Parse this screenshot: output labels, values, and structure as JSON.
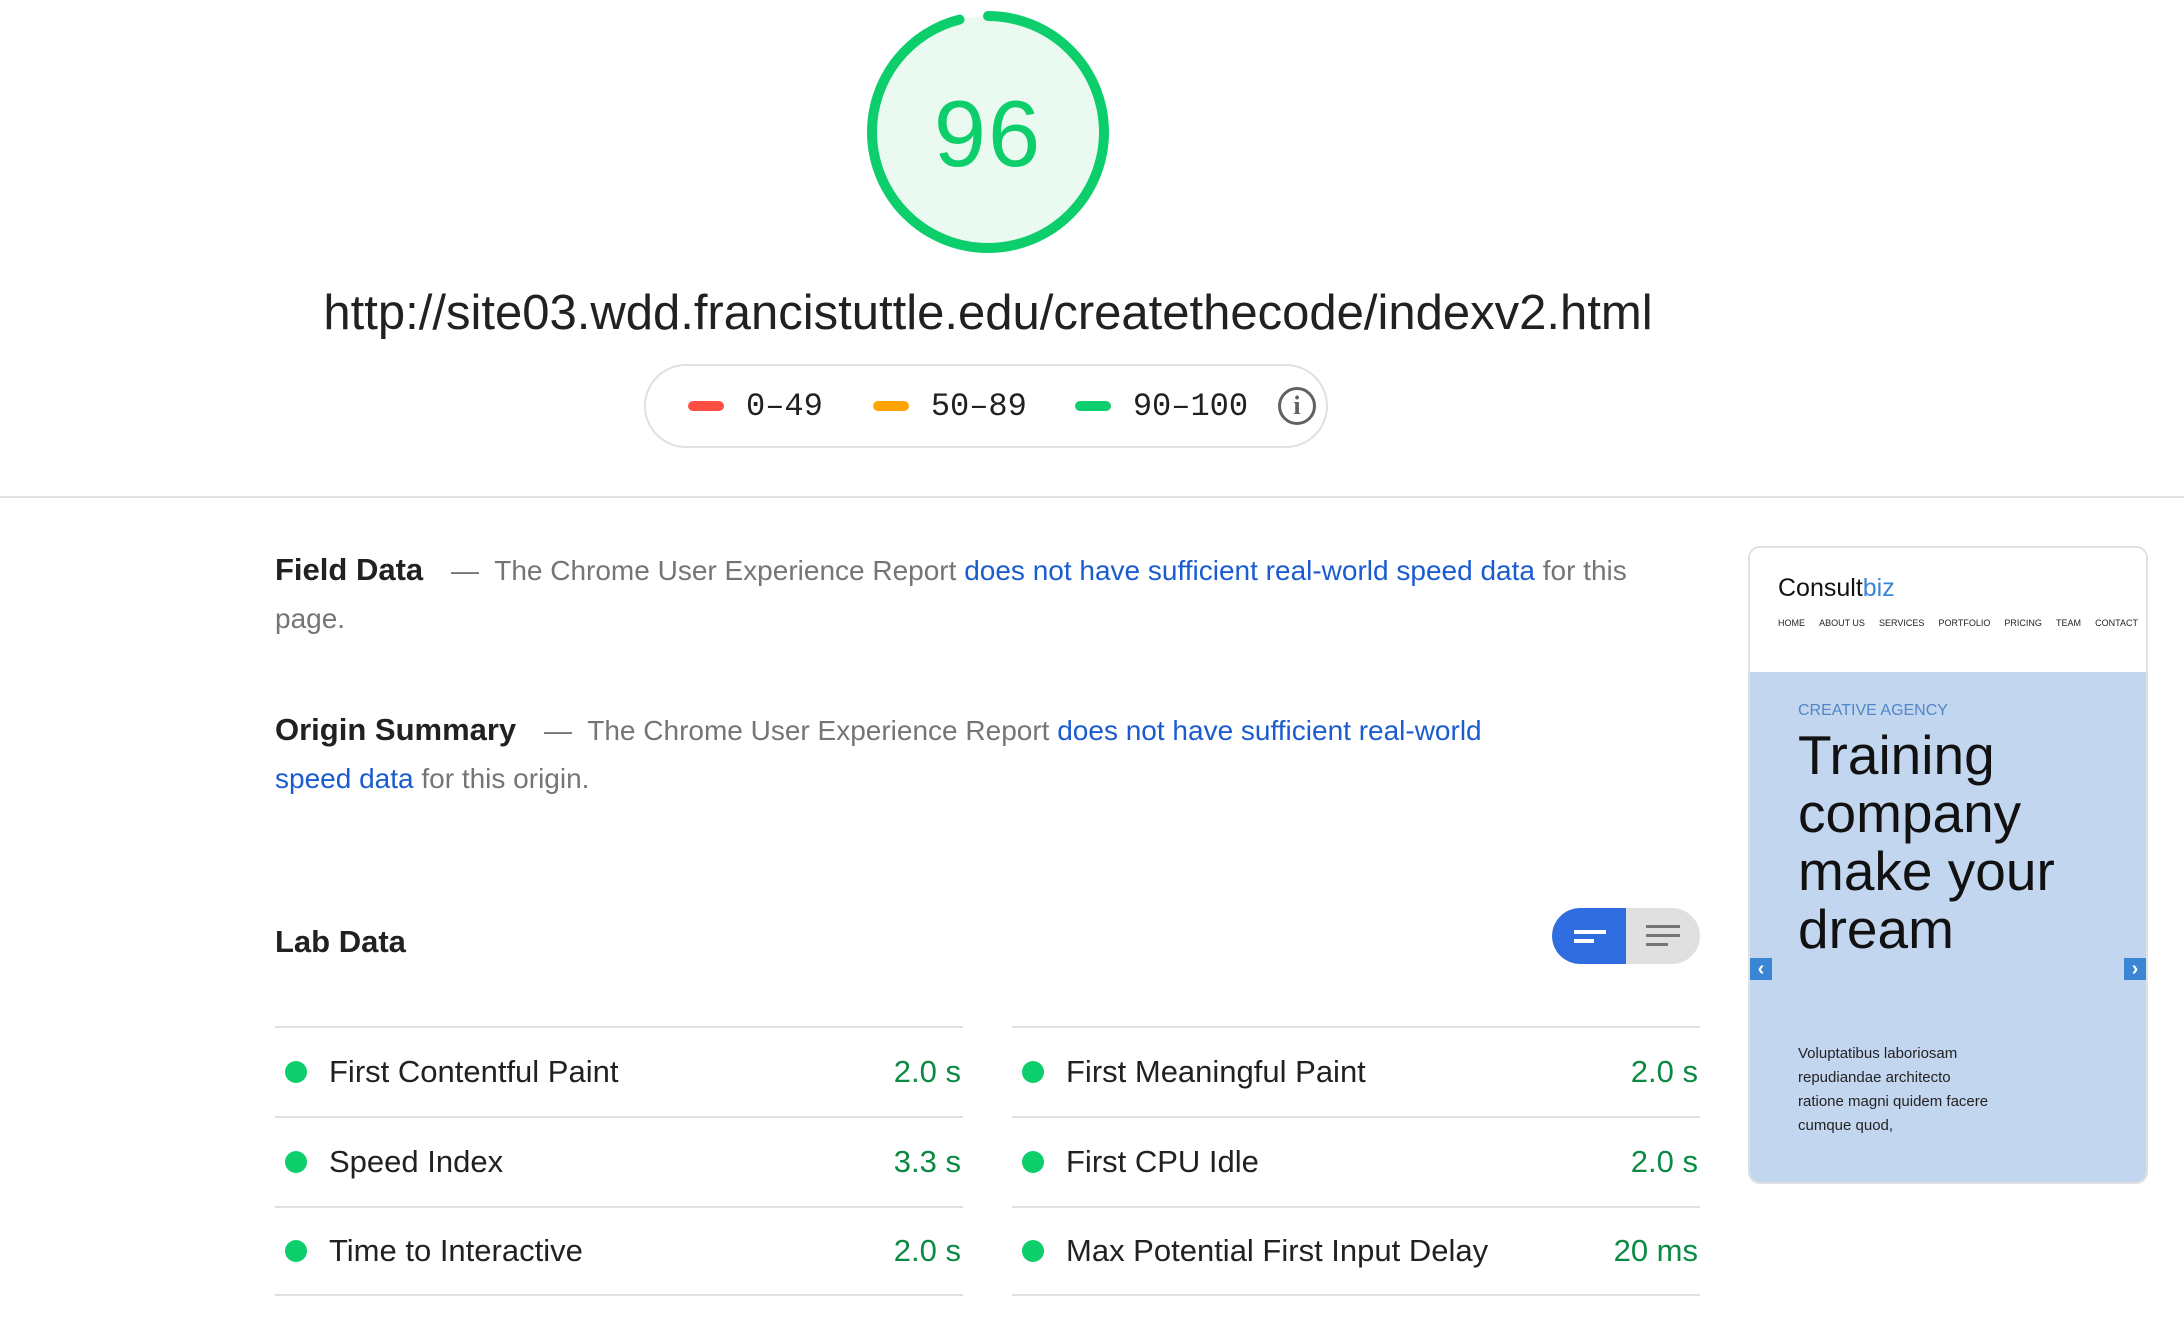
{
  "score": {
    "value": "96",
    "fraction": 0.96,
    "color": "#0cce6b"
  },
  "url": "http://site03.wdd.francistuttle.edu/createthecode/indexv2.html",
  "legend": {
    "items": [
      {
        "label": "0–49",
        "color": "#ff4e42"
      },
      {
        "label": "50–89",
        "color": "#ffa400"
      },
      {
        "label": "90–100",
        "color": "#0cce6b"
      }
    ],
    "info_icon": "info-icon"
  },
  "field_data": {
    "title": "Field Data",
    "dash": "—",
    "text_before": "The Chrome User Experience Report",
    "link": "does not have sufficient real-world speed data",
    "text_after": "for this page."
  },
  "origin_summary": {
    "title": "Origin Summary",
    "dash": "—",
    "text_before": "The Chrome User Experience Report",
    "link": "does not have sufficient real-world speed data",
    "text_after": "for this origin."
  },
  "lab_data": {
    "title": "Lab Data",
    "toggle": {
      "selected": "summary-view",
      "options": [
        "summary-view-icon",
        "detail-view-icon"
      ]
    },
    "metrics_left": [
      {
        "name": "First Contentful Paint",
        "value": "2.0 s"
      },
      {
        "name": "Speed Index",
        "value": "3.3 s"
      },
      {
        "name": "Time to Interactive",
        "value": "2.0 s"
      }
    ],
    "metrics_right": [
      {
        "name": "First Meaningful Paint",
        "value": "2.0 s"
      },
      {
        "name": "First CPU Idle",
        "value": "2.0 s"
      },
      {
        "name": "Max Potential First Input Delay",
        "value": "20 ms"
      }
    ],
    "status_color": "#0cce6b"
  },
  "thumbnail": {
    "brand_main": "Consult",
    "brand_accent": "biz",
    "nav": [
      "HOME",
      "ABOUT US",
      "SERVICES",
      "PORTFOLIO",
      "PRICING",
      "TEAM",
      "CONTACT"
    ],
    "eyebrow": "CREATIVE AGENCY",
    "headline": "Training company make your dream",
    "body": "Voluptatibus laboriosam repudiandae architecto ratione magni quidem facere cumque quod,"
  }
}
